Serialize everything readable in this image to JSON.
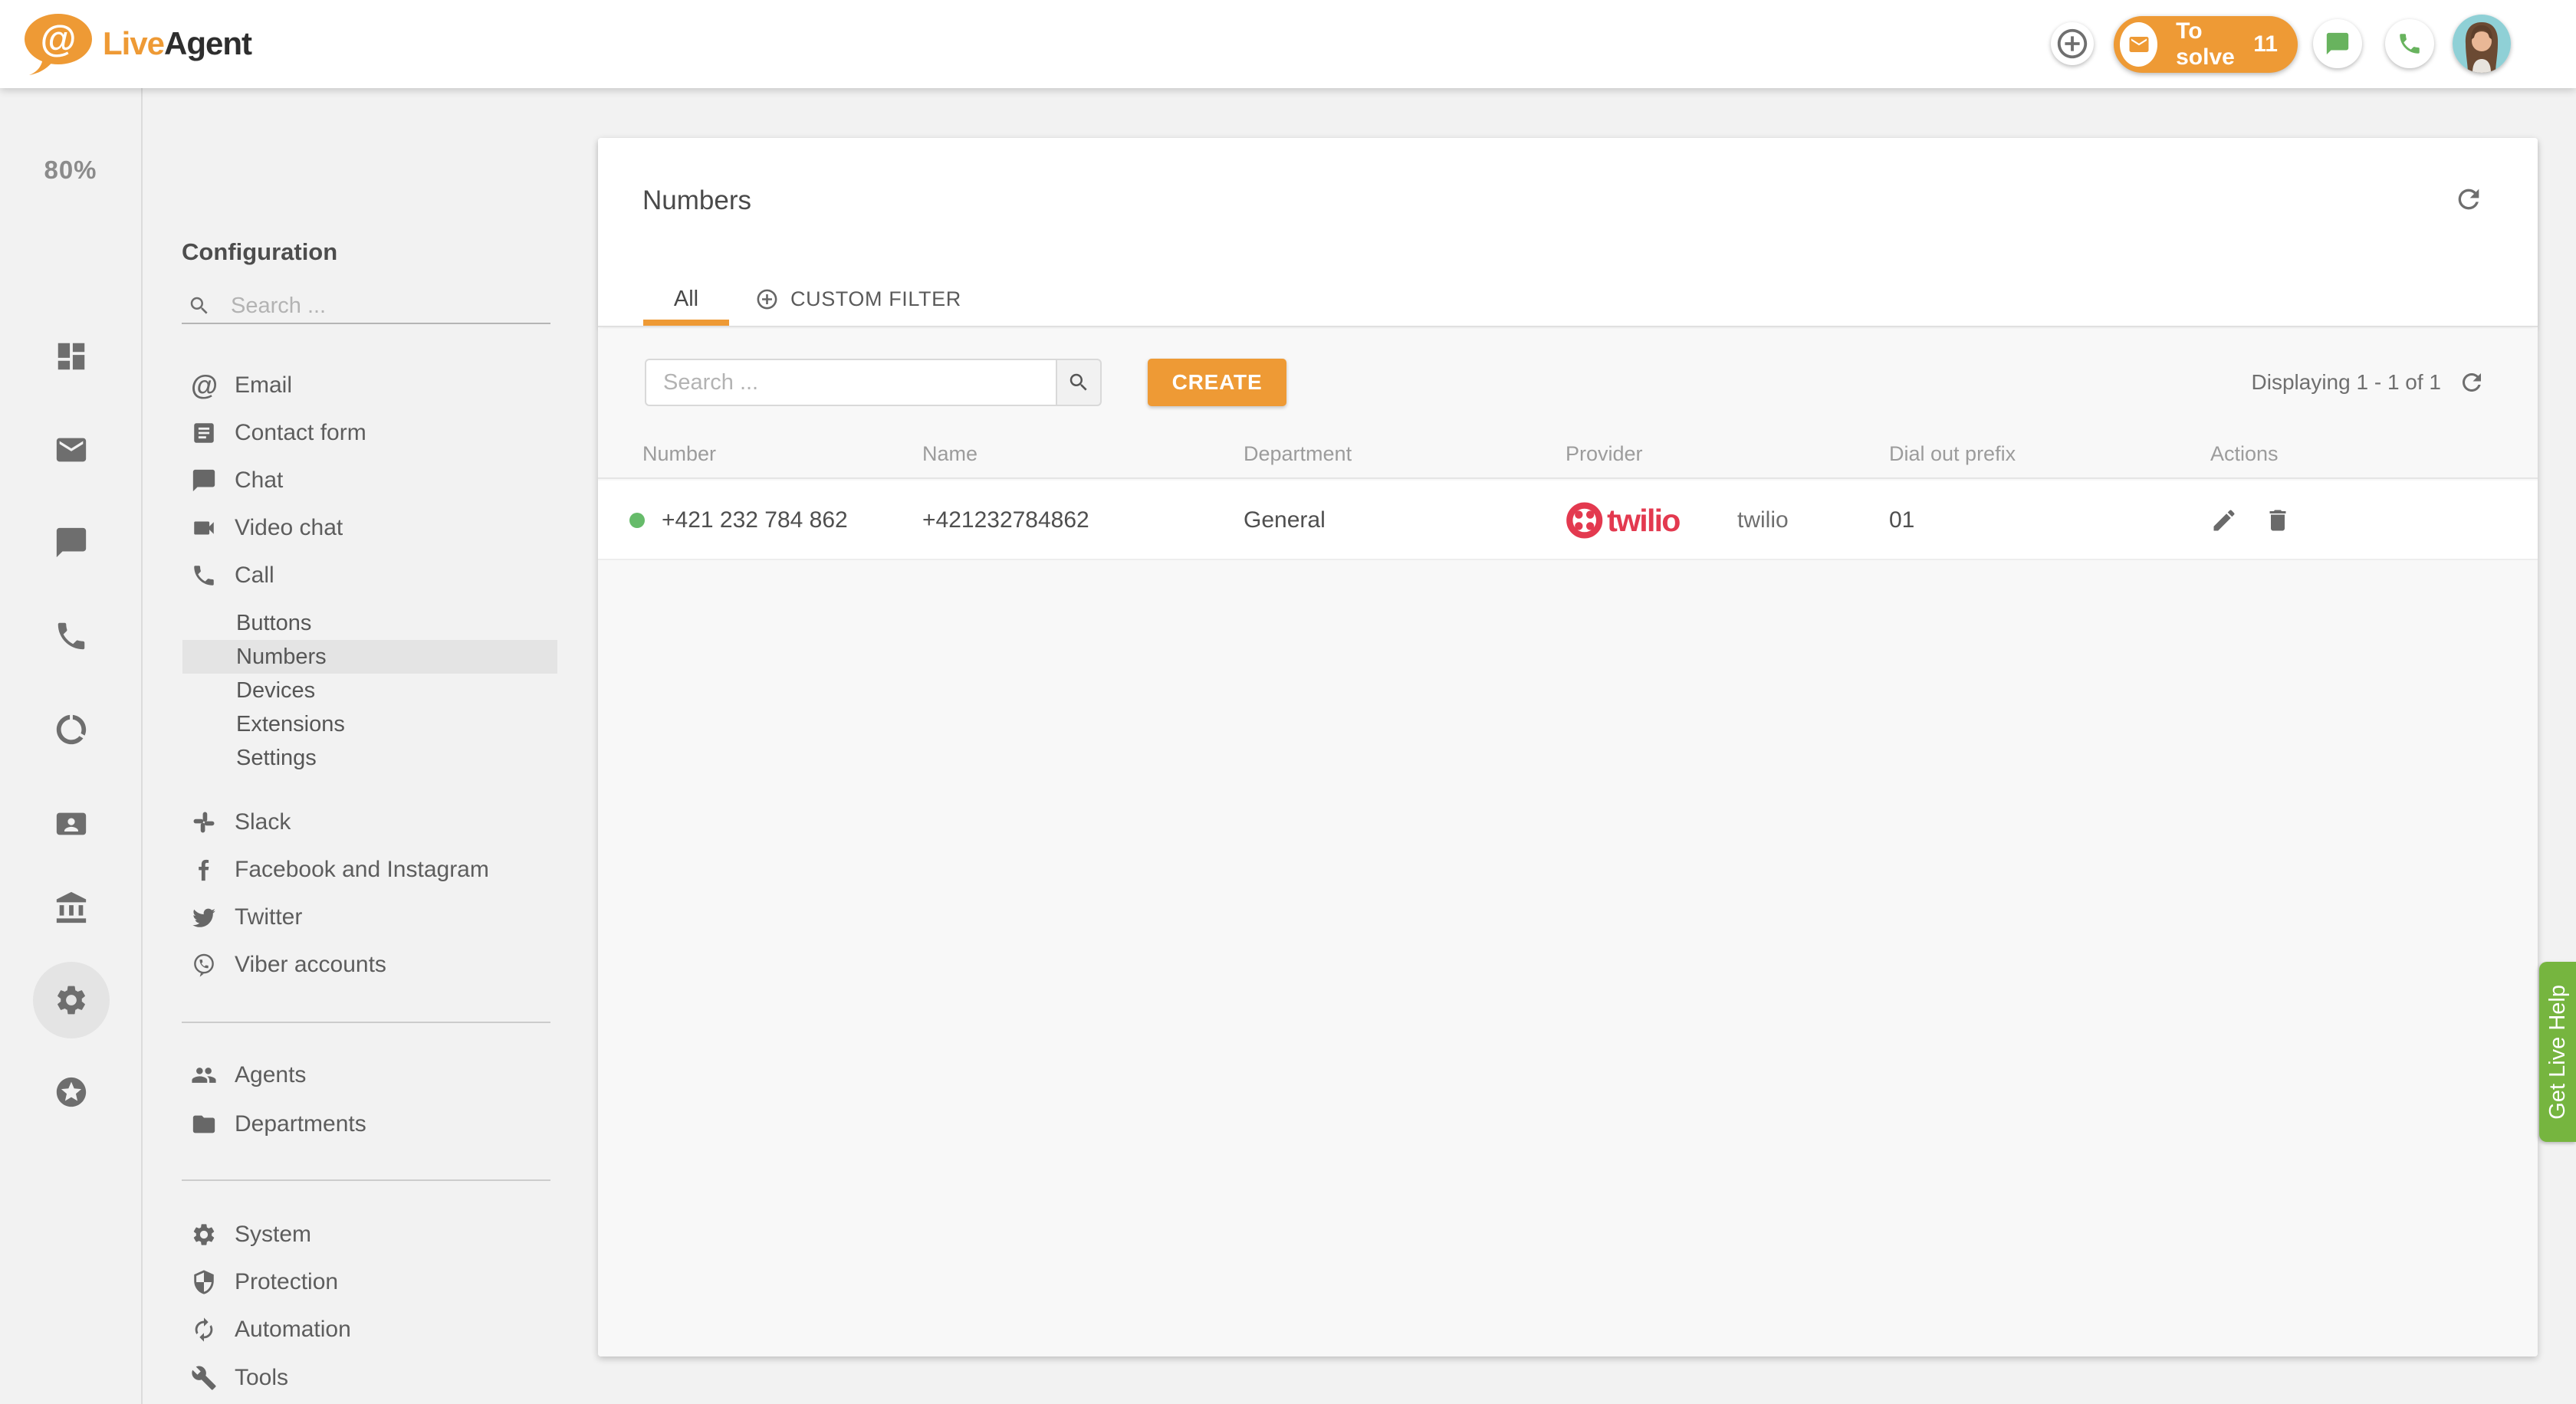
{
  "header": {
    "logo": {
      "live": "Live",
      "agent": "Agent"
    },
    "to_solve": {
      "label": "To solve",
      "count": "11"
    }
  },
  "rail": {
    "utilization": "80%"
  },
  "config_sidebar": {
    "title": "Configuration",
    "search_placeholder": "Search ...",
    "channels": [
      {
        "icon": "email",
        "label": "Email"
      },
      {
        "icon": "contact-form",
        "label": "Contact form"
      },
      {
        "icon": "chat",
        "label": "Chat"
      },
      {
        "icon": "video-chat",
        "label": "Video chat"
      },
      {
        "icon": "call",
        "label": "Call"
      }
    ],
    "call_subitems": [
      {
        "label": "Buttons",
        "active": false
      },
      {
        "label": "Numbers",
        "active": true
      },
      {
        "label": "Devices",
        "active": false
      },
      {
        "label": "Extensions",
        "active": false
      },
      {
        "label": "Settings",
        "active": false
      }
    ],
    "integrations": [
      {
        "icon": "slack",
        "label": "Slack"
      },
      {
        "icon": "facebook",
        "label": "Facebook and Instagram"
      },
      {
        "icon": "twitter",
        "label": "Twitter"
      },
      {
        "icon": "viber",
        "label": "Viber accounts"
      }
    ],
    "people": [
      {
        "icon": "agents",
        "label": "Agents"
      },
      {
        "icon": "departments",
        "label": "Departments"
      }
    ],
    "system": [
      {
        "icon": "system",
        "label": "System"
      },
      {
        "icon": "protection",
        "label": "Protection"
      },
      {
        "icon": "automation",
        "label": "Automation"
      },
      {
        "icon": "tools",
        "label": "Tools"
      }
    ]
  },
  "main": {
    "title": "Numbers",
    "tabs": [
      {
        "label": "All",
        "active": true
      },
      {
        "label": "CUSTOM FILTER",
        "active": false
      }
    ],
    "toolbar": {
      "search_placeholder": "Search ...",
      "create_label": "CREATE",
      "displaying": "Displaying 1 - 1 of 1"
    },
    "table": {
      "columns": [
        "Number",
        "Name",
        "Department",
        "Provider",
        "Dial out prefix",
        "Actions"
      ],
      "rows": [
        {
          "status": "active",
          "number": "+421 232 784 862",
          "name": "+421232784862",
          "department": "General",
          "provider_logo_text": "twilio",
          "provider": "twilio",
          "dial_out_prefix": "01"
        }
      ]
    }
  },
  "help_tab": {
    "label": "Get Live Help"
  },
  "colors": {
    "accent_orange": "#ee9a35",
    "icon_green": "#68b35e",
    "status_green": "#66bb6a",
    "help_green": "#76b53f",
    "twilio_red": "#e3394f"
  }
}
